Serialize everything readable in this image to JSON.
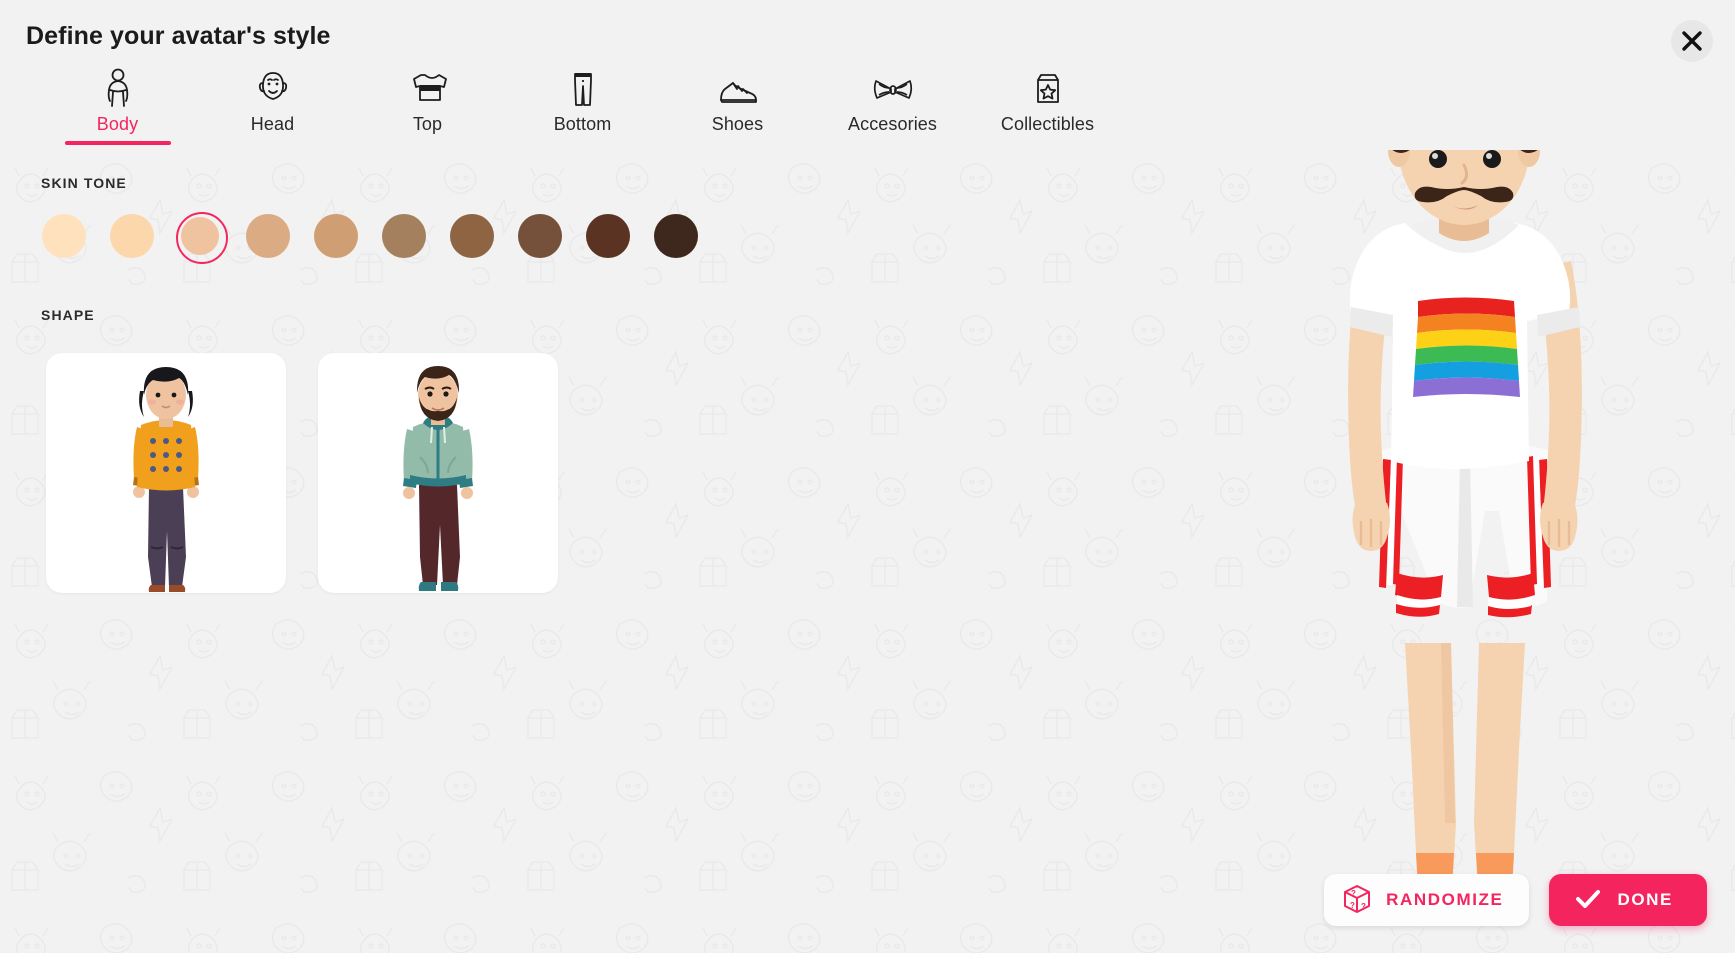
{
  "header": {
    "title": "Define your avatar's style",
    "close_icon": "close-icon"
  },
  "tabs": [
    {
      "label": "Body",
      "icon": "body-icon",
      "active": true
    },
    {
      "label": "Head",
      "icon": "head-icon",
      "active": false
    },
    {
      "label": "Top",
      "icon": "tshirt-icon",
      "active": false
    },
    {
      "label": "Bottom",
      "icon": "pants-icon",
      "active": false
    },
    {
      "label": "Shoes",
      "icon": "shoe-icon",
      "active": false
    },
    {
      "label": "Accesories",
      "icon": "bowtie-icon",
      "active": false
    },
    {
      "label": "Collectibles",
      "icon": "star-box-icon",
      "active": false
    }
  ],
  "sections": {
    "skin_tone_label": "SKIN TONE",
    "shape_label": "SHAPE"
  },
  "skin_tones": [
    {
      "color": "#ffe1bd",
      "selected": false
    },
    {
      "color": "#fcd7ab",
      "selected": false
    },
    {
      "color": "#f0c3a0",
      "selected": true
    },
    {
      "color": "#dbab84",
      "selected": false
    },
    {
      "color": "#cf9e72",
      "selected": false
    },
    {
      "color": "#a5805e",
      "selected": false
    },
    {
      "color": "#8e6442",
      "selected": false
    },
    {
      "color": "#75503a",
      "selected": false
    },
    {
      "color": "#5a3323",
      "selected": false
    },
    {
      "color": "#3e271c",
      "selected": false
    }
  ],
  "shapes": [
    {
      "name": "feminine-shape",
      "selected": false,
      "hair": "#17171c",
      "top": "#f0a01d",
      "top_cuff": "#b2711b",
      "pattern_dot": "#4a5a84",
      "bottom": "#4a3f54",
      "shoes": "#9a4b2a",
      "skin": "#f0c3a0"
    },
    {
      "name": "masculine-shape",
      "selected": false,
      "hair": "#3b2418",
      "top": "#93bba9",
      "top_cuff": "#2e7c84",
      "shirt": "#c0503c",
      "bottom": "#54282b",
      "shoes": "#2f7a80",
      "skin": "#f0c3a0"
    }
  ],
  "avatar": {
    "skin": "#f6d3b0",
    "skin_shadow": "#e8bd95",
    "hair": "#3b2418",
    "hair_light": "#5a3a24",
    "shirt": "#ffffff",
    "shirt_shadow": "#ebebeb",
    "rainbow": [
      "#e8221e",
      "#f58220",
      "#fdd116",
      "#3cba54",
      "#14a0e0",
      "#8b6fd4"
    ],
    "shorts": "#fafafa",
    "shorts_shadow": "#e9e9e9",
    "shorts_stripe": "#ec2024",
    "socks": "#f79a5c",
    "shoes": "#3a2820"
  },
  "actions": {
    "randomize_label": "RANDOMIZE",
    "randomize_icon": "dice-icon",
    "done_label": "DONE",
    "done_icon": "check-icon"
  },
  "colors": {
    "accent": "#f4255e",
    "background": "#f2f2f2",
    "card": "#ffffff",
    "text": "#1b1b1b"
  }
}
